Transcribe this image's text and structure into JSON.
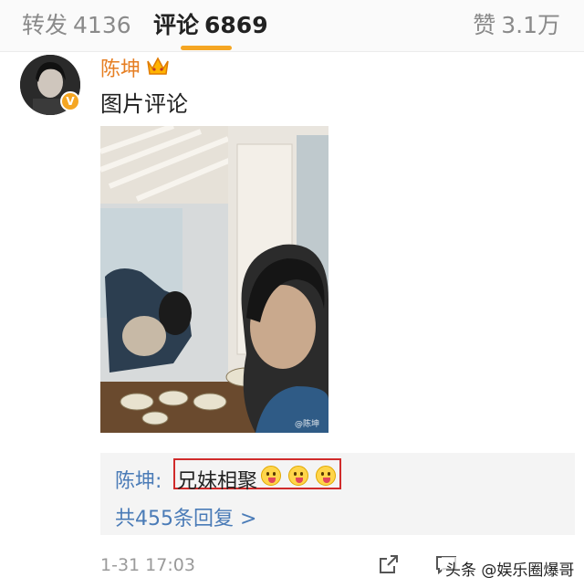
{
  "tabs": {
    "repost": {
      "label": "转发",
      "count": "4136"
    },
    "comment": {
      "label": "评论",
      "count": "6869"
    },
    "like": {
      "label": "赞",
      "count": "3.1万"
    }
  },
  "comment": {
    "author": "陈坤",
    "text": "图片评论",
    "image_watermark": "@陈坤",
    "badge": "V"
  },
  "reply": {
    "author": "陈坤:",
    "text": "兄妹相聚",
    "emoji_icon": "tongue-out-face-icon",
    "view_replies": "共455条回复 >"
  },
  "footer": {
    "timestamp": "1-31 17:03",
    "source": "头条 @娱乐圈爆哥"
  },
  "colors": {
    "accent": "#f5a623",
    "author_name": "#e67e22",
    "link": "#4a7bb7",
    "highlight_border": "#d02b2b"
  }
}
